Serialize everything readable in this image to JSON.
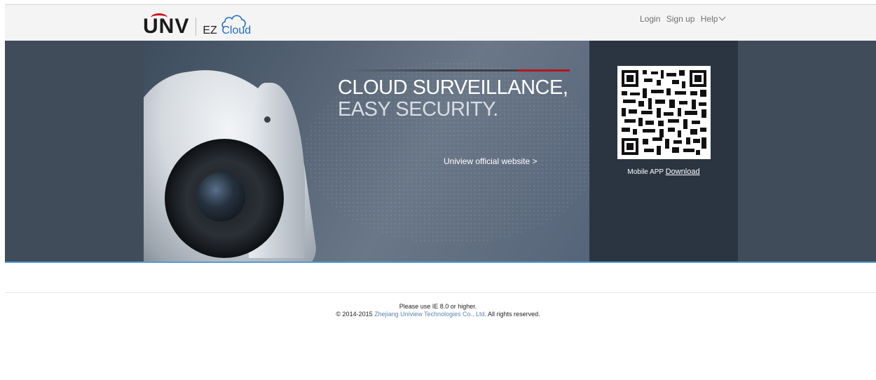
{
  "brand": {
    "logo_text": "UNV",
    "product_prefix": "EZ",
    "product_suffix": "Cloud",
    "accent_red": "#c8141c",
    "accent_blue": "#1e6bc6"
  },
  "nav": {
    "login": "Login",
    "signup": "Sign up",
    "help": "Help"
  },
  "banner": {
    "headline_line1": "CLOUD SURVEILLANCE,",
    "headline_line2": "EASY SECURITY.",
    "official_link": "Uniview official website >",
    "background": "#404c5a"
  },
  "qr": {
    "mobile_label": "Mobile APP ",
    "download_link": "Download"
  },
  "footer": {
    "ie_note": "Please use IE 8.0 or higher.",
    "copyright_prefix": "© 2014-2015 ",
    "company": "Zhejiang Uniview Technologies Co., Ltd.",
    "copyright_suffix": " All rights reserved."
  }
}
